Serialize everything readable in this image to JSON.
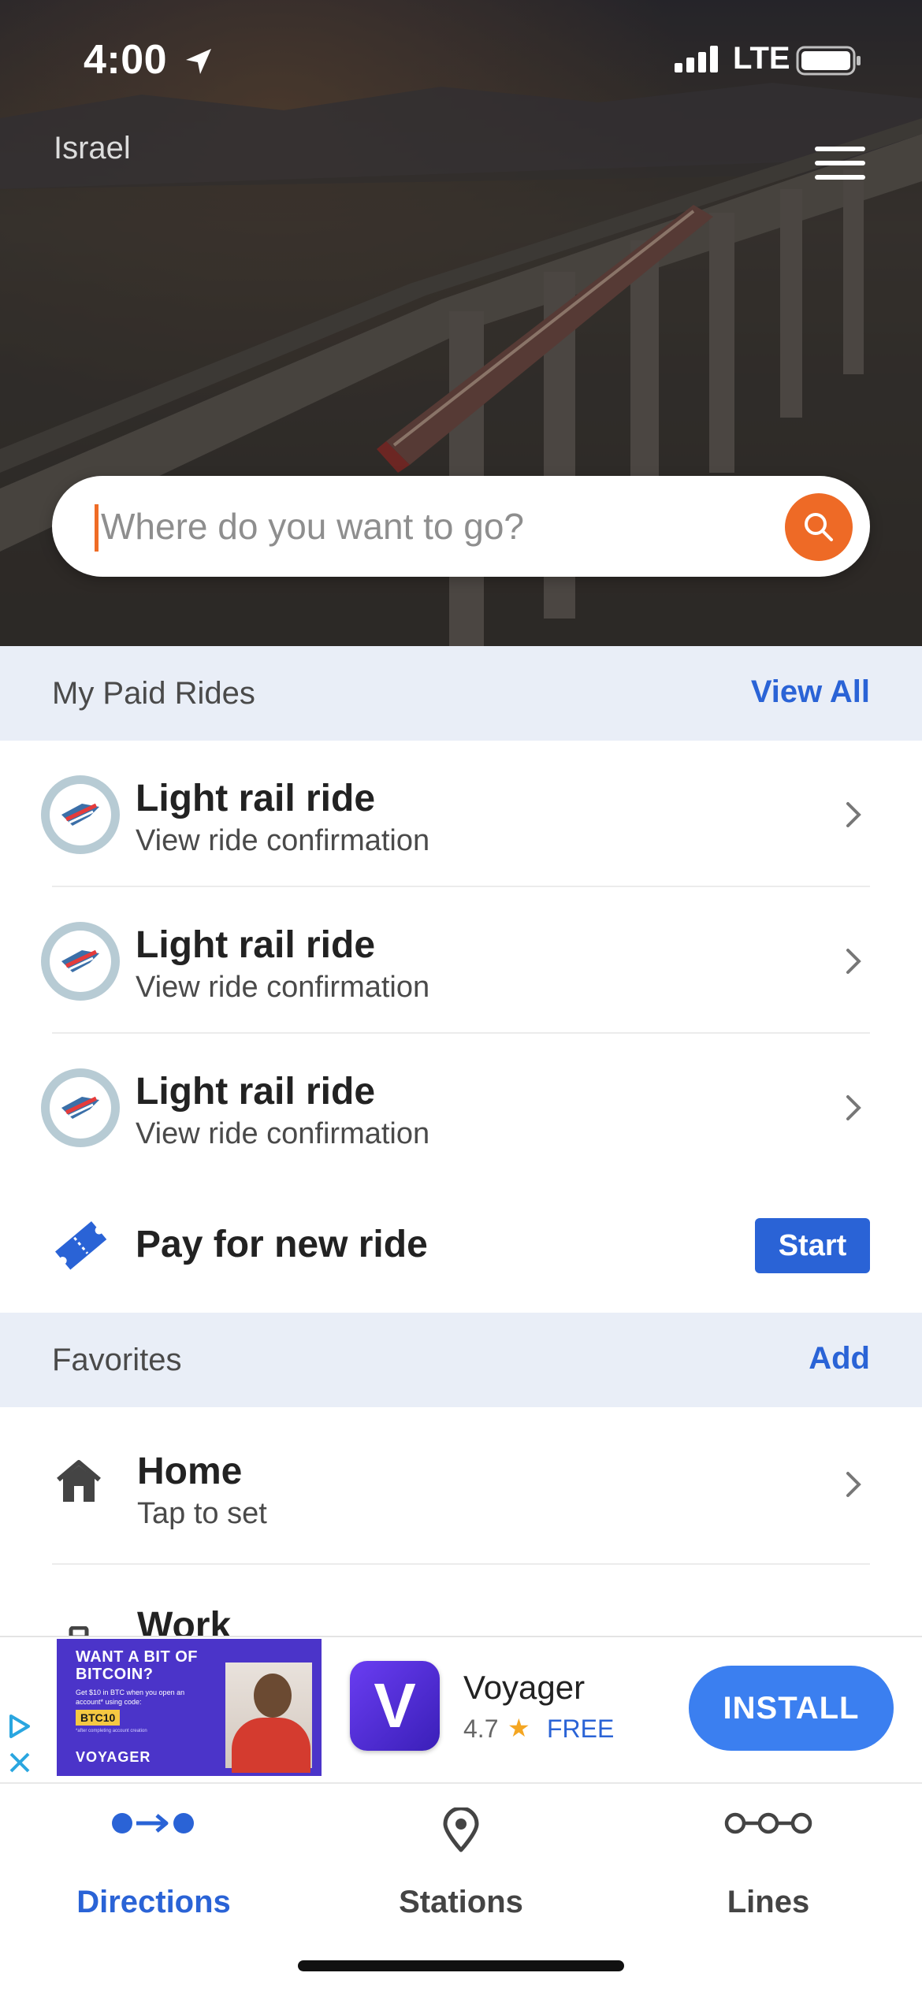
{
  "status_bar": {
    "time": "4:00",
    "carrier": "LTE"
  },
  "header": {
    "region": "Israel",
    "menu_icon": "hamburger-icon"
  },
  "search": {
    "placeholder": "Where do you want to go?",
    "value": "",
    "icon": "search-icon",
    "accent_color": "#ee6a26"
  },
  "paid_rides": {
    "title": "My Paid Rides",
    "action": "View All",
    "items": [
      {
        "title": "Light rail ride",
        "subtitle": "View ride confirmation"
      },
      {
        "title": "Light rail ride",
        "subtitle": "View ride confirmation"
      },
      {
        "title": "Light rail ride",
        "subtitle": "View ride confirmation"
      }
    ],
    "pay": {
      "label": "Pay for new ride",
      "button": "Start"
    }
  },
  "favorites": {
    "title": "Favorites",
    "action": "Add",
    "items": [
      {
        "title": "Home",
        "subtitle": "Tap to set",
        "icon": "home-icon"
      },
      {
        "title": "Work",
        "subtitle": "",
        "icon": "briefcase-icon"
      }
    ]
  },
  "ad": {
    "banner": {
      "headline": "WANT A BIT OF BITCOIN?",
      "body": "Get $10 in BTC when you open an account* using code:",
      "code": "BTC10",
      "footnote": "*after completing account creation",
      "brand": "VOYAGER"
    },
    "app_icon_letter": "V",
    "app_name": "Voyager",
    "rating": "4.7",
    "price": "FREE",
    "install": "INSTALL"
  },
  "tabs": [
    {
      "label": "Directions",
      "icon": "directions-icon",
      "active": true
    },
    {
      "label": "Stations",
      "icon": "location-pin-icon",
      "active": false
    },
    {
      "label": "Lines",
      "icon": "lines-icon",
      "active": false
    }
  ],
  "colors": {
    "primary_blue": "#2a63d6",
    "section_bg": "#e9eef7",
    "install_blue": "#3b7ff0"
  }
}
